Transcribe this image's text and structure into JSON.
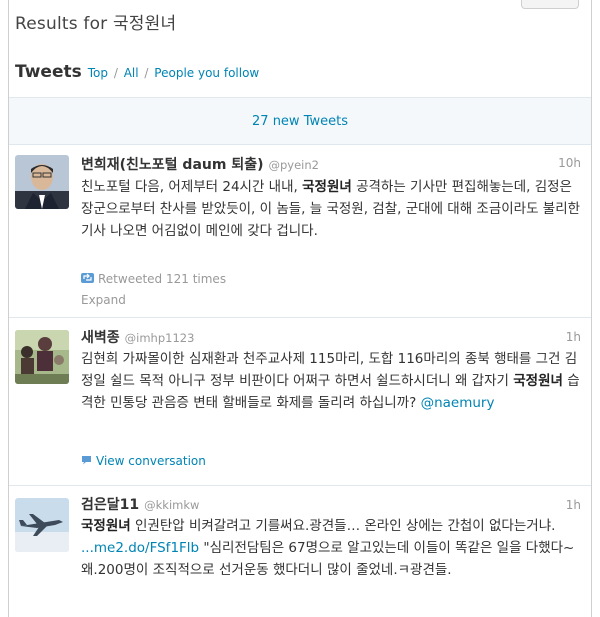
{
  "header": {
    "results_title": "Results for 국정원녀",
    "tweets_title": "Tweets",
    "filter_top": "Top",
    "filter_sep": "/",
    "filter_all": "All",
    "filter_follow": "People you follow"
  },
  "new_tweets": "27 new Tweets",
  "tweets": [
    {
      "name": "변희재(친노포털 daum 퇴출)",
      "handle": "@pyein2",
      "time": "10h",
      "text_1": "친노포털 다음, 어제부터 24시간 내내, ",
      "text_kw": "국정원녀",
      "text_2": " 공격하는 기사만 편집해놓는데, 김정은 장군으로부터 찬사를 받았듯이, 이 놈들, 늘 국정원, 검찰, 군대에 대해 조금이라도 불리한 기사 나오면 어김없이 메인에 갖다 겁니다.",
      "retweeted": "Retweeted 121 times",
      "expand": "Expand"
    },
    {
      "name": "새벽종",
      "handle": "@imhp1123",
      "time": "1h",
      "text_1": "김현희 가짜몰이한 심재환과 천주교사제 115마리, 도합 116마리의 종북 행태를 그건 김정일 쉴드 목적 아니구 정부 비판이다 어쩌구 하면서 쉴드하시더니 왜 갑자기 ",
      "text_kw": "국정원녀",
      "text_2": " 습격한 민통당 관음증 변태 할배들로 화제를 돌리려 하십니까? ",
      "mention": "@naemury",
      "conversation": "View conversation"
    },
    {
      "name": "검은달11",
      "handle": "@kkimkw",
      "time": "1h",
      "text_kw": "국정원녀",
      "text_1": " 인권탄압 비켜갈려고 기를써요.광견들… 온라인 상에는 간첩이 없다는거냐. ",
      "link": "...me2.do/FSf1Flb",
      "text_2": " \"심리전담팀은 67명으로 알고있는데 이들이 똑같은 일을 다했다~ 왜.200명이 조직적으로 선거운동 했다더니 많이 줄었네.ㅋ광견들."
    }
  ]
}
